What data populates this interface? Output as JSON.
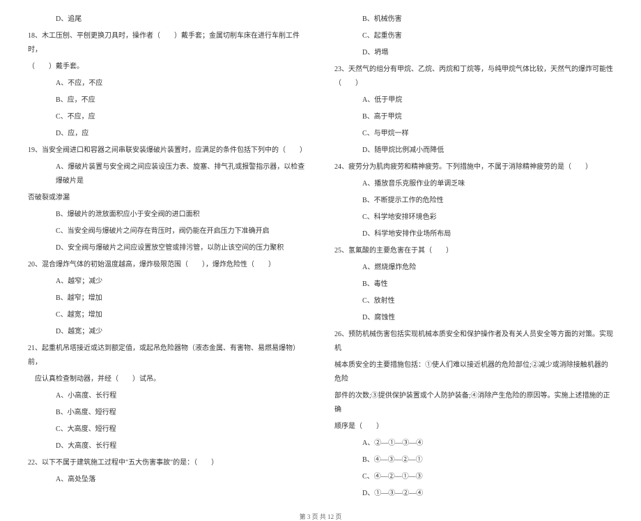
{
  "left_column": {
    "q17_optD": "D、追尾",
    "q18_text": "18、木工压刨、平刨更换刀具时，操作者（　　）戴手套；金属切削车床在进行车削工件时，",
    "q18_text2": "（　　）戴手套。",
    "q18_optA": "A、不应，不应",
    "q18_optB": "B、应，不应",
    "q18_optC": "C、不应，应",
    "q18_optD": "D、应，应",
    "q19_text": "19、当安全阀进口和容器之间串联安装爆破片装置时，应满足的条件包括下列中的（　　）",
    "q19_optA": "A、爆破片装置与安全阀之间应装设压力表、旋塞、排气孔或报警指示器，以检查爆破片是",
    "q19_optA2": "否破裂或渗漏",
    "q19_optB": "B、爆破片的泄放面积应小于安全阀的进口面积",
    "q19_optC": "C、当安全阀与爆破片之间存在背压时，阀仍能在开启压力下准确开启",
    "q19_optD": "D、安全阀与爆破片之间应设置放空管或排污管，以防止该空间的压力聚积",
    "q20_text": "20、混合爆炸气体的初始温度越高，爆炸极限范围（　　），爆炸危险性（　　）",
    "q20_optA": "A、越窄；减少",
    "q20_optB": "B、越窄；增加",
    "q20_optC": "C、越宽；增加",
    "q20_optD": "D、越宽；减少",
    "q21_text": "21、起重机吊塔接近或达到额定值，或起吊危险器物（液态金属、有害物、易燃易爆物）前，",
    "q21_text2": "　应认真检查制动器，并经（　　）试吊。",
    "q21_optA": "A、小高度、长行程",
    "q21_optB": "B、小高度、短行程",
    "q21_optC": "C、大高度、短行程",
    "q21_optD": "D、大高度、长行程",
    "q22_text": "22、以下不属于建筑施工过程中\"五大伤害事故\"的是：（　　）",
    "q22_optA": "A、高处坠落"
  },
  "right_column": {
    "q22_optB": "B、机械伤害",
    "q22_optC": "C、起重伤害",
    "q22_optD": "D、坍塌",
    "q23_text": "23、天然气的组分有甲烷、乙烷、丙烷和丁烷等，与纯甲烷气体比较，天然气的爆炸可能性（　　）",
    "q23_optA": "A、低于甲烷",
    "q23_optB": "B、高于甲烷",
    "q23_optC": "C、与甲烷一样",
    "q23_optD": "D、随甲烷比例减小而降低",
    "q24_text": "24、疲劳分为肌肉疲劳和精神疲劳。下列措施中，不属于消除精神疲劳的是（　　）",
    "q24_optA": "A、播放音乐克服作业的单调乏味",
    "q24_optB": "B、不断提示工作的危险性",
    "q24_optC": "C、科学地安排环境色彩",
    "q24_optD": "D、科学地安排作业场所布局",
    "q25_text": "25、氢氟酸的主要危害在于其（　　）",
    "q25_optA": "A、燃烧爆炸危险",
    "q25_optB": "B、毒性",
    "q25_optC": "C、放射性",
    "q25_optD": "D、腐蚀性",
    "q26_text": "26、预防机械伤害包括实现机械本质安全和保护操作者及有关人员安全等方面的对策。实现机",
    "q26_text2": "械本质安全的主要措施包括：①使人们难以接近机器的危险部位;②减少或消除接触机器的危险",
    "q26_text3": "部件的次数;③提供保护装置或个人防护装备;④消除产生危险的原因等。实施上述措施的正确",
    "q26_text4": "顺序是（　　）",
    "q26_optA": "A、②—①—③—④",
    "q26_optB": "B、④—③—②—①",
    "q26_optC": "C、④—②—①—③",
    "q26_optD": "D、①—③—②—④"
  },
  "footer": "第 3 页 共 12 页"
}
